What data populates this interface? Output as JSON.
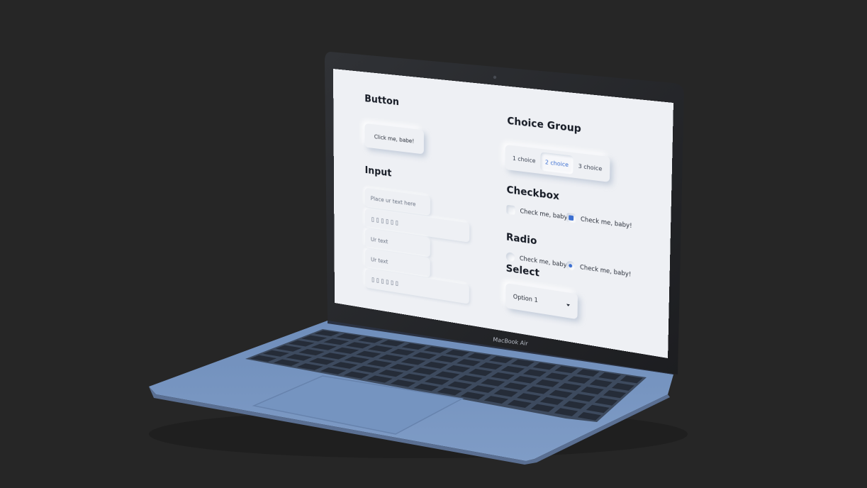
{
  "device": {
    "brand_label": "MacBook Air"
  },
  "colors": {
    "background": "#262626",
    "body": "#7b98c2",
    "screen_bg": "#eef0f4",
    "accent": "#3c6fd1"
  },
  "button_section": {
    "title": "Button",
    "button_label": "Click me, babe!"
  },
  "input_section": {
    "title": "Input",
    "fields": [
      {
        "placeholder": "Place ur text here",
        "value": ""
      },
      {
        "value": "▯▯▯▯▯▯"
      },
      {
        "value": "Ur text"
      },
      {
        "value": "Ur text"
      },
      {
        "value": "▯▯▯▯▯▯"
      }
    ]
  },
  "choice_group": {
    "title": "Choice Group",
    "options": [
      "1 choice",
      "2 choice",
      "3 choice"
    ],
    "selected": "2 choice"
  },
  "checkbox_section": {
    "title": "Checkbox",
    "items": [
      {
        "label": "Check me, baby!",
        "checked": false
      },
      {
        "label": "Check me, baby!",
        "checked": true
      }
    ]
  },
  "radio_section": {
    "title": "Radio",
    "items": [
      {
        "label": "Check me, baby!",
        "checked": false
      },
      {
        "label": "Check me, baby!",
        "checked": true
      }
    ]
  },
  "select_section": {
    "title": "Select",
    "value": "Option 1"
  }
}
